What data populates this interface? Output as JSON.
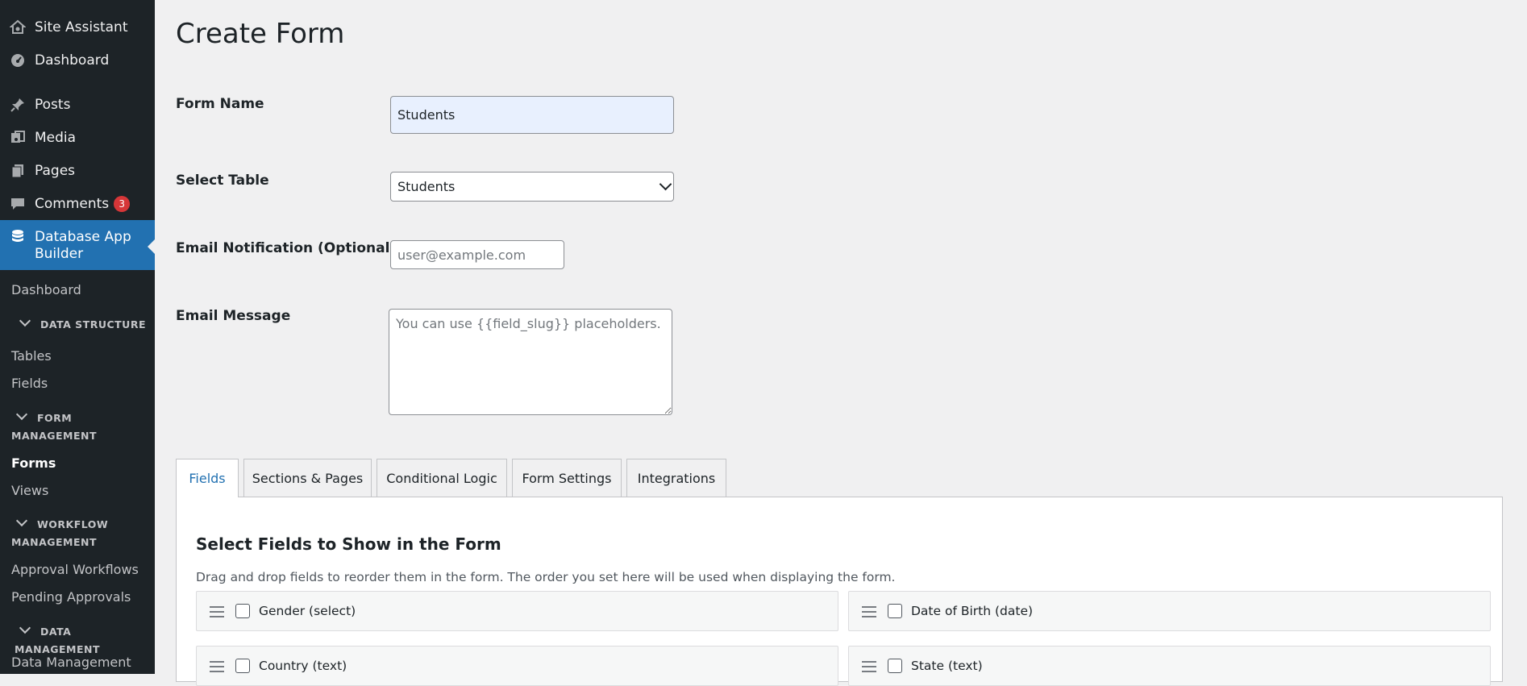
{
  "sidebar": {
    "items": [
      {
        "label": "Site Assistant",
        "icon": "home-gear-icon"
      },
      {
        "label": "Dashboard",
        "icon": "dashboard-gauge-icon"
      },
      {
        "label": "Posts",
        "icon": "pushpin-icon"
      },
      {
        "label": "Media",
        "icon": "media-icon"
      },
      {
        "label": "Pages",
        "icon": "pages-icon"
      },
      {
        "label": "Comments",
        "icon": "comment-bubble-icon",
        "badge": "3"
      },
      {
        "label": "Database App Builder",
        "icon": "database-icon",
        "active": true
      }
    ],
    "submenu": {
      "dashboard": "Dashboard",
      "data_structure": "DATA STRUCTURE",
      "tables": "Tables",
      "fields": "Fields",
      "form_management": "FORM MANAGEMENT",
      "forms": "Forms",
      "views": "Views",
      "workflow_management": "WORKFLOW MANAGEMENT",
      "approval_workflows": "Approval Workflows",
      "pending_approvals": "Pending Approvals",
      "data_management": "DATA MANAGEMENT",
      "data_management_item": "Data Management"
    }
  },
  "page": {
    "title": "Create Form",
    "form_name_label": "Form Name",
    "form_name_value": "Students",
    "select_table_label": "Select Table",
    "select_table_value": "Students",
    "email_notification_label": "Email Notification (Optional)",
    "email_notification_placeholder": "user@example.com",
    "email_message_label": "Email Message",
    "email_message_placeholder": "You can use {{field_slug}} placeholders."
  },
  "tabs": [
    {
      "label": "Fields",
      "active": true
    },
    {
      "label": "Sections & Pages"
    },
    {
      "label": "Conditional Logic"
    },
    {
      "label": "Form Settings"
    },
    {
      "label": "Integrations"
    }
  ],
  "fields_panel": {
    "title": "Select Fields to Show in the Form",
    "description": "Drag and drop fields to reorder them in the form. The order you set here will be used when displaying the form.",
    "fields": [
      {
        "label": "Gender (select)",
        "checked": false
      },
      {
        "label": "Date of Birth (date)",
        "checked": false
      },
      {
        "label": "Country (text)",
        "checked": false
      },
      {
        "label": "State (text)",
        "checked": false
      }
    ]
  },
  "colors": {
    "sidebar_bg": "#1d2327",
    "active_menu": "#2271b1",
    "badge": "#d63638",
    "page_bg": "#f0f0f1"
  }
}
